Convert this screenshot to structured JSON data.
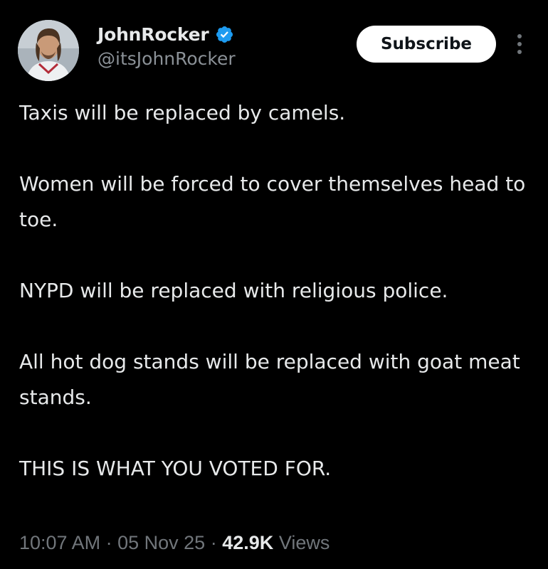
{
  "author": {
    "display_name": "JohnRocker",
    "handle": "@itsJohnRocker",
    "verified": true,
    "verified_color": "#1d9bf0",
    "avatar_icon": "profile-photo"
  },
  "header": {
    "subscribe_label": "Subscribe",
    "more_icon": "vertical-ellipsis-icon"
  },
  "tweet": {
    "paragraphs": [
      "Taxis will be replaced by camels.",
      "Women will be forced to cover themselves head to toe.",
      "NYPD will be replaced with religious police.",
      "All hot dog stands will be replaced with goat meat stands.",
      "THIS IS WHAT YOU VOTED FOR."
    ]
  },
  "meta": {
    "time": "10:07 AM",
    "separator": "·",
    "date": "05 Nov 25",
    "views_count": "42.9K",
    "views_label": "Views"
  },
  "colors": {
    "background": "#000000",
    "text_primary": "#e7e9ea",
    "text_secondary": "#71767b",
    "button_bg": "#ffffff"
  }
}
